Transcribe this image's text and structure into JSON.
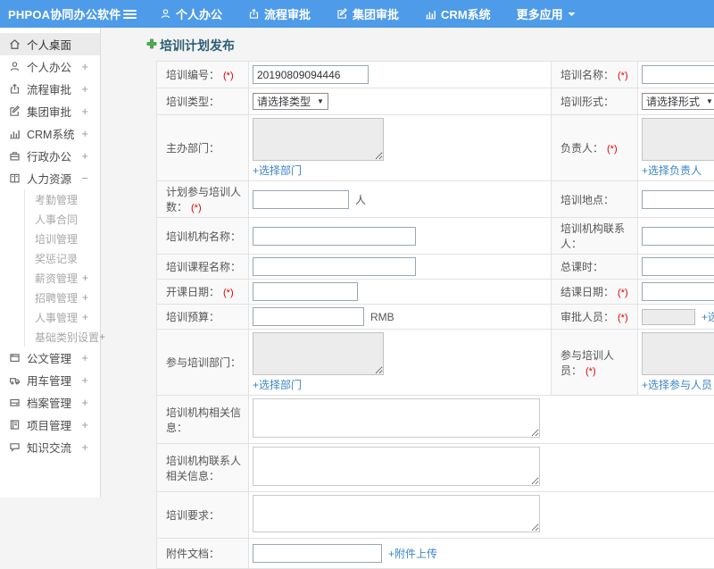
{
  "topbar": {
    "logo": "PHPOA协同办公软件",
    "nav": [
      {
        "label": "个人办公",
        "icon": "user-icon"
      },
      {
        "label": "流程审批",
        "icon": "flow-icon"
      },
      {
        "label": "集团审批",
        "icon": "edit-icon"
      },
      {
        "label": "CRM系统",
        "icon": "chart-icon"
      },
      {
        "label": "更多应用",
        "icon": "caret-down-icon"
      }
    ]
  },
  "sidebar": {
    "items": [
      {
        "label": "个人桌面",
        "icon": "home-icon",
        "expand": ""
      },
      {
        "label": "个人办公",
        "icon": "user-icon",
        "expand": "+"
      },
      {
        "label": "流程审批",
        "icon": "flow-icon",
        "expand": "+"
      },
      {
        "label": "集团审批",
        "icon": "edit-icon",
        "expand": "+"
      },
      {
        "label": "CRM系统",
        "icon": "chart-icon",
        "expand": "+"
      },
      {
        "label": "行政办公",
        "icon": "briefcase-icon",
        "expand": "+"
      },
      {
        "label": "人力资源",
        "icon": "hr-icon",
        "expand": "−"
      }
    ],
    "hr_children": [
      {
        "label": "考勤管理",
        "expand": ""
      },
      {
        "label": "人事合同",
        "expand": ""
      },
      {
        "label": "培训管理",
        "expand": ""
      },
      {
        "label": "奖惩记录",
        "expand": ""
      },
      {
        "label": "薪资管理",
        "expand": "+"
      },
      {
        "label": "招聘管理",
        "expand": "+"
      },
      {
        "label": "人事管理",
        "expand": "+"
      },
      {
        "label": "基础类别设置",
        "expand": "+"
      }
    ],
    "items_bottom": [
      {
        "label": "公文管理",
        "icon": "doc-icon",
        "expand": "+"
      },
      {
        "label": "用车管理",
        "icon": "car-icon",
        "expand": "+"
      },
      {
        "label": "档案管理",
        "icon": "archive-icon",
        "expand": "+"
      },
      {
        "label": "项目管理",
        "icon": "project-icon",
        "expand": "+"
      },
      {
        "label": "知识交流",
        "icon": "chat-icon",
        "expand": "+"
      }
    ]
  },
  "form": {
    "title": "培训计划发布",
    "required_mark": "(*)",
    "training_no": {
      "label": "培训编号：",
      "value": "20190809094446"
    },
    "training_name": {
      "label": "培训名称："
    },
    "training_type": {
      "label": "培训类型：",
      "selected": "请选择类型"
    },
    "training_form": {
      "label": "培训形式：",
      "selected": "请选择形式"
    },
    "host_dept": {
      "label": "主办部门：",
      "link": "+选择部门"
    },
    "leader": {
      "label": "负责人：",
      "link": "+选择负责人"
    },
    "planned_count": {
      "label": "计划参与培训人数：",
      "suffix": "人"
    },
    "location": {
      "label": "培训地点："
    },
    "org_name": {
      "label": "培训机构名称："
    },
    "org_contact": {
      "label": "培训机构联系人："
    },
    "course_name": {
      "label": "培训课程名称："
    },
    "total_hours": {
      "label": "总课时："
    },
    "start_date": {
      "label": "开课日期："
    },
    "end_date": {
      "label": "结课日期："
    },
    "budget": {
      "label": "培训预算：",
      "suffix": "RMB"
    },
    "approver": {
      "label": "审批人员：",
      "link": "+选择审批人员"
    },
    "join_dept": {
      "label": "参与培训部门：",
      "link": "+选择部门"
    },
    "join_people": {
      "label": "参与培训人员：",
      "link": "+选择参与人员"
    },
    "org_info": {
      "label": "培训机构相关信息："
    },
    "org_contact_info": {
      "label": "培训机构联系人相关信息："
    },
    "requirement": {
      "label": "培训要求："
    },
    "attachment": {
      "label": "附件文档：",
      "link": "+附件上传"
    }
  }
}
